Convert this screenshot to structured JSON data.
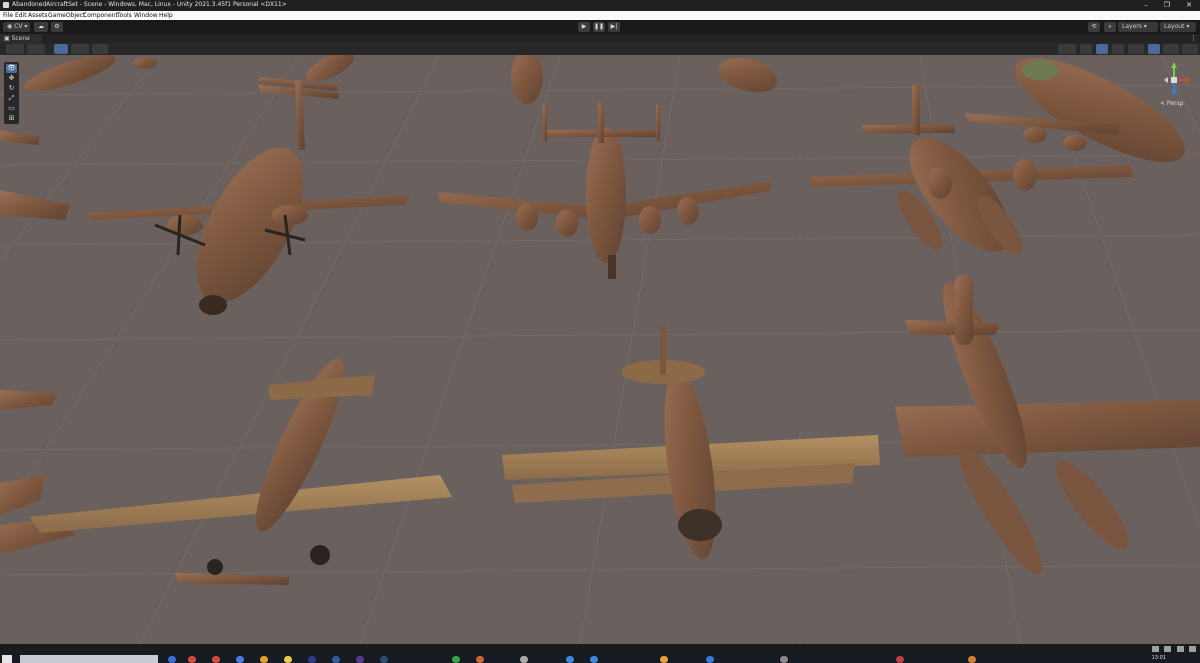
{
  "window": {
    "title": "AbandonedAircraftSet - Scene - Windows, Mac, Linux - Unity 2021.3.45f1 Personal <DX11>",
    "controls": [
      "minimize-icon",
      "restore-icon",
      "close-icon"
    ]
  },
  "menu": [
    "File",
    "Edit",
    "Assets",
    "GameObject",
    "Component",
    "Tools",
    "Window",
    "Help"
  ],
  "toolbar": {
    "account_label": "CV",
    "play_controls": [
      "play-icon",
      "pause-icon",
      "step-icon"
    ],
    "layers_label": "Layers",
    "layout_label": "Layout"
  },
  "scene_tab": {
    "label": "Scene"
  },
  "scene_view": {
    "camera_label": "< Persp",
    "gizmo_axes": [
      "y",
      "x",
      "z"
    ],
    "tools": [
      "view-tool-icon",
      "move-tool-icon",
      "rotate-tool-icon",
      "scale-tool-icon",
      "rect-tool-icon",
      "transform-tool-icon"
    ],
    "ground_color": "#6a615f",
    "grid_color": "#7b7371",
    "aircraft_color": "#8a6248"
  },
  "taskbar": {
    "time": "13:01"
  },
  "colors": {
    "accent": "#4b6a9a",
    "titlebar": "#202020",
    "menubar": "#fafafa",
    "toolbar": "#191919"
  }
}
